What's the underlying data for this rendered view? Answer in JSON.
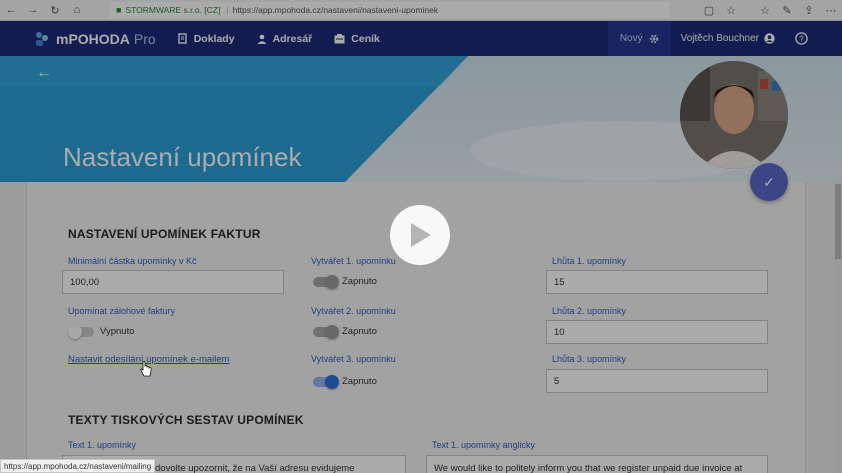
{
  "browser": {
    "site_identity": "STORMWARE s.r.o. [CZ]",
    "url": "https://app.mpohoda.cz/nastaveni/nastaveni-upominek",
    "status_url": "https://app.mpohoda.cz/nastaveni/mailing"
  },
  "header": {
    "app_name": "mPOHODA",
    "app_suffix": "Pro",
    "nav": [
      {
        "label": "Doklady",
        "icon": "documents-icon"
      },
      {
        "label": "Adresář",
        "icon": "person-icon"
      },
      {
        "label": "Ceník",
        "icon": "pricelist-icon"
      }
    ],
    "new_label": "Nový",
    "user_name": "Vojtěch Bouchner",
    "brand_color": "#1d2a7a"
  },
  "hero": {
    "title": "Nastavení upomínek"
  },
  "section1": {
    "heading": "NASTAVENÍ UPOMÍNEK FAKTUR",
    "min_amount_label": "Minimální částka upomínky v Kč",
    "min_amount_value": "100,00",
    "advance_label": "Upomínat zálohové faktury",
    "advance_state": "Vypnuto",
    "email_link": "Nastavit odesílání upomínek e-mailem",
    "create1_label": "Vytvářet 1. upomínku",
    "create1_state": "Zapnuto",
    "create2_label": "Vytvářet 2. upomínku",
    "create2_state": "Zapnuto",
    "create3_label": "Vytvářet 3. upomínku",
    "create3_state": "Zapnuto",
    "deadline1_label": "Lhůta 1. upomínky",
    "deadline1_value": "15",
    "deadline2_label": "Lhůta 2. upomínky",
    "deadline2_value": "10",
    "deadline3_label": "Lhůta 3. upomínky",
    "deadline3_value": "5"
  },
  "section2": {
    "heading": "TEXTY TISKOVÝCH SESTAV UPOMÍNEK",
    "text1_label": "Text 1. upomínky",
    "text1_value": "dovolte upozornit, že na Vaší adresu evidujeme",
    "text1_en_label": "Text 1. upomínky anglicky",
    "text1_en_value": "We would like to politely inform you that we register unpaid due invoice at"
  }
}
